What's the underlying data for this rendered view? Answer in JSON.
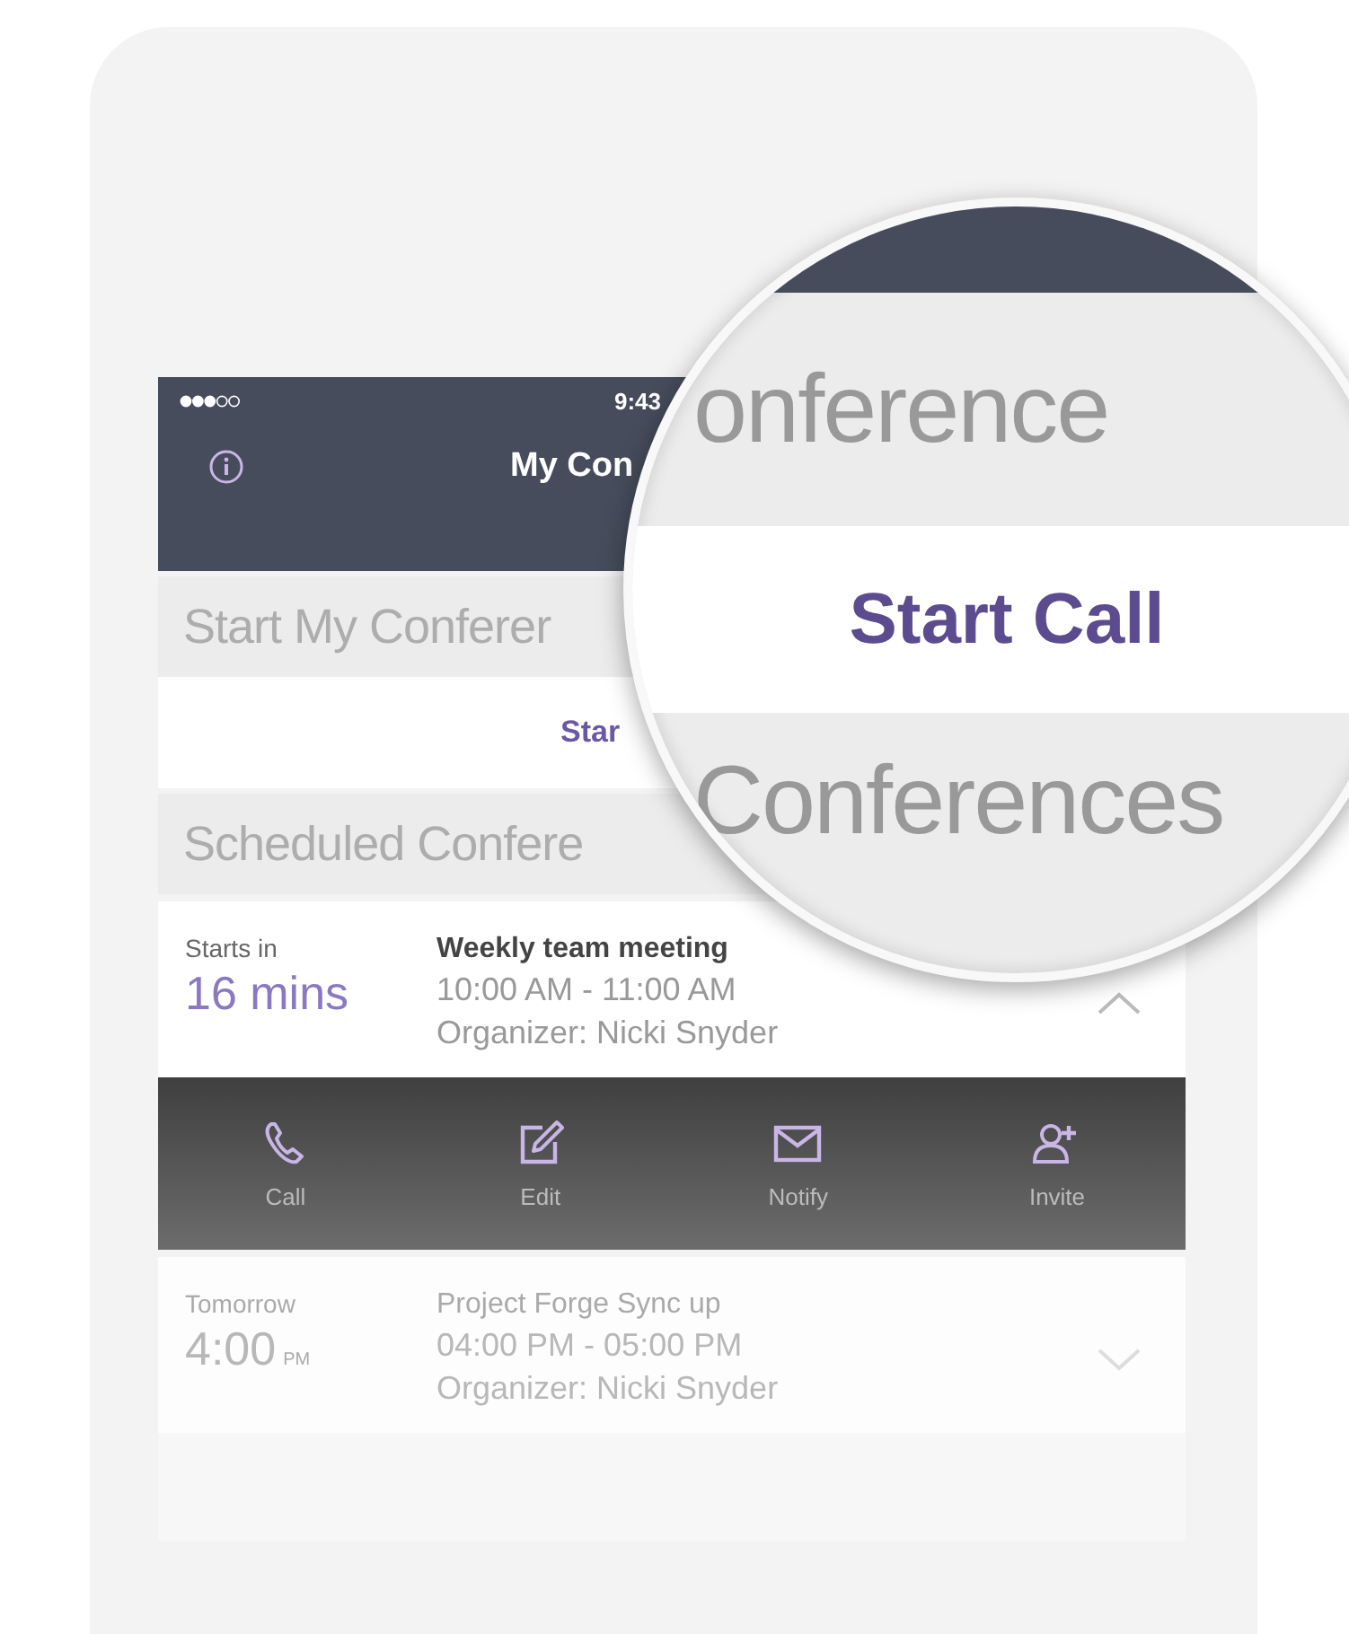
{
  "status_bar": {
    "time": "9:43"
  },
  "nav": {
    "title": "My Con"
  },
  "start_section": {
    "header": "Start My Conferer",
    "action": "Star"
  },
  "scheduled_section": {
    "header": "Scheduled Confere"
  },
  "meetings": [
    {
      "when": "Starts in",
      "time": "16 mins",
      "title": "Weekly team meeting",
      "hours": "10:00 AM - 11:00 AM",
      "organizer": "Organizer: Nicki Snyder",
      "expanded": true,
      "dimmed": false,
      "actions": [
        {
          "kind": "phone",
          "label": "Call"
        },
        {
          "kind": "edit",
          "label": "Edit"
        },
        {
          "kind": "mail",
          "label": "Notify"
        },
        {
          "kind": "invite",
          "label": "Invite"
        }
      ]
    },
    {
      "when": "Tomorrow",
      "time": "4:00",
      "time_suffix": "PM",
      "title": "Project Forge Sync up",
      "hours": "04:00 PM - 05:00 PM",
      "organizer": "Organizer: Nicki Snyder",
      "expanded": false,
      "dimmed": true
    }
  ],
  "magnifier": {
    "lines": [
      {
        "kind": "header",
        "text": "onference"
      },
      {
        "kind": "action",
        "text": "Start Call"
      },
      {
        "kind": "header",
        "text": "Conferences"
      }
    ]
  }
}
